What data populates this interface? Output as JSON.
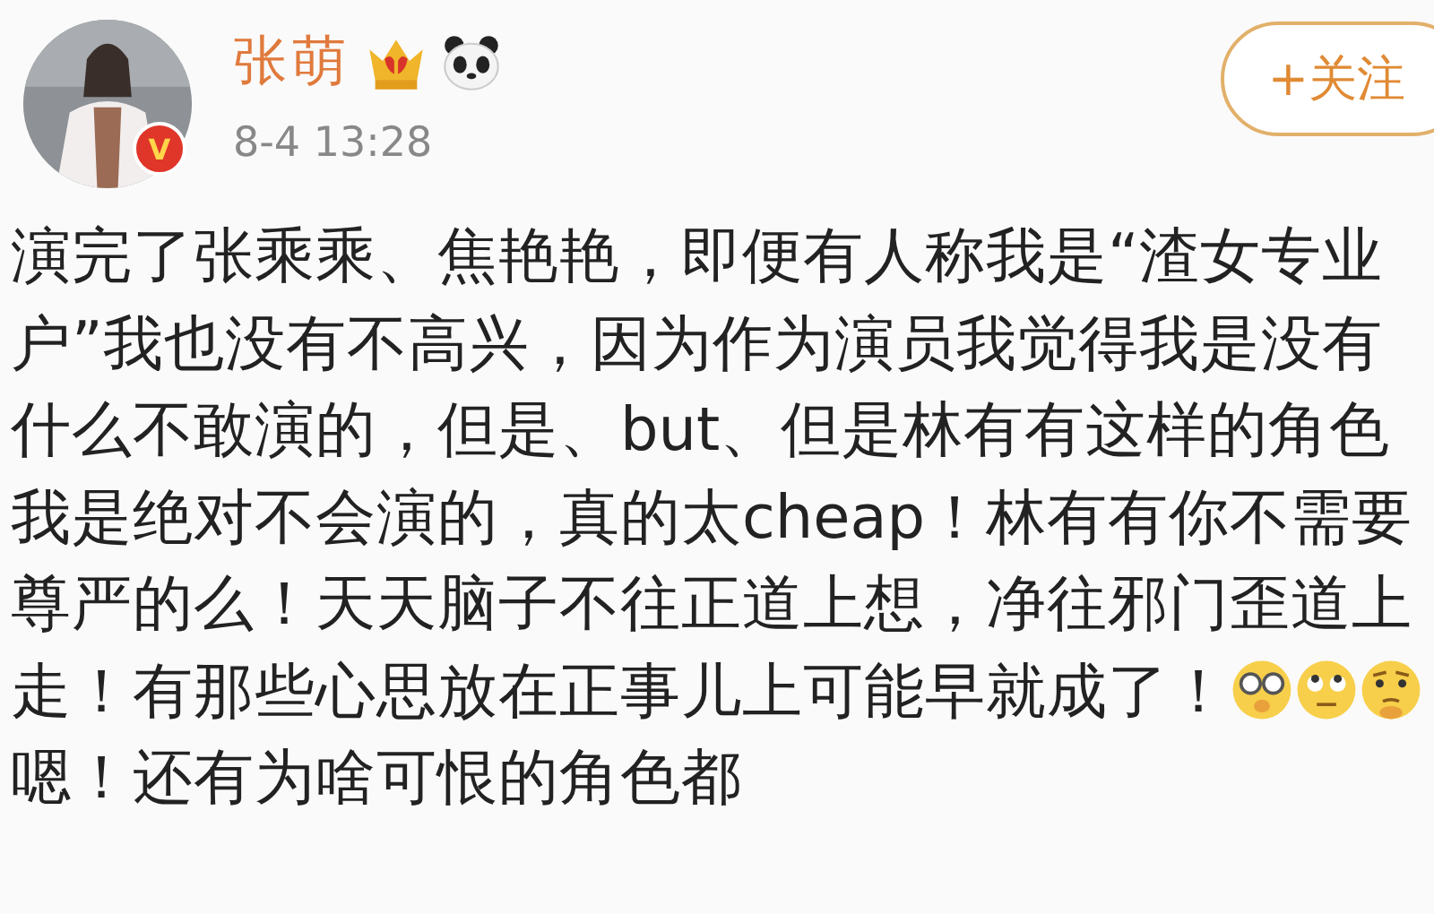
{
  "post": {
    "author": {
      "name": "张萌",
      "verified_badge": "V",
      "time": "8-4 13:28"
    },
    "follow_button": "+关注",
    "body": [
      {
        "kind": "text",
        "text": "演完了张乘乘、焦艳艳，即便有人称我是“渣女专业户”我也没有不高兴，因为作为演员我觉得我是没有什么不敢演的，但是、but、但是林有有这样的角色我是绝对不会演的，真的太cheap！林有有你不需要尊严的么！天天脑子不往正道上想，净往邪门歪道上走！有那些心思放在正事儿上可能早就成了！"
      },
      {
        "kind": "glasses"
      },
      {
        "kind": "eyeroll"
      },
      {
        "kind": "thinking"
      },
      {
        "kind": "text",
        "text": "嗯！还有为啥可恨的角色都"
      }
    ]
  }
}
